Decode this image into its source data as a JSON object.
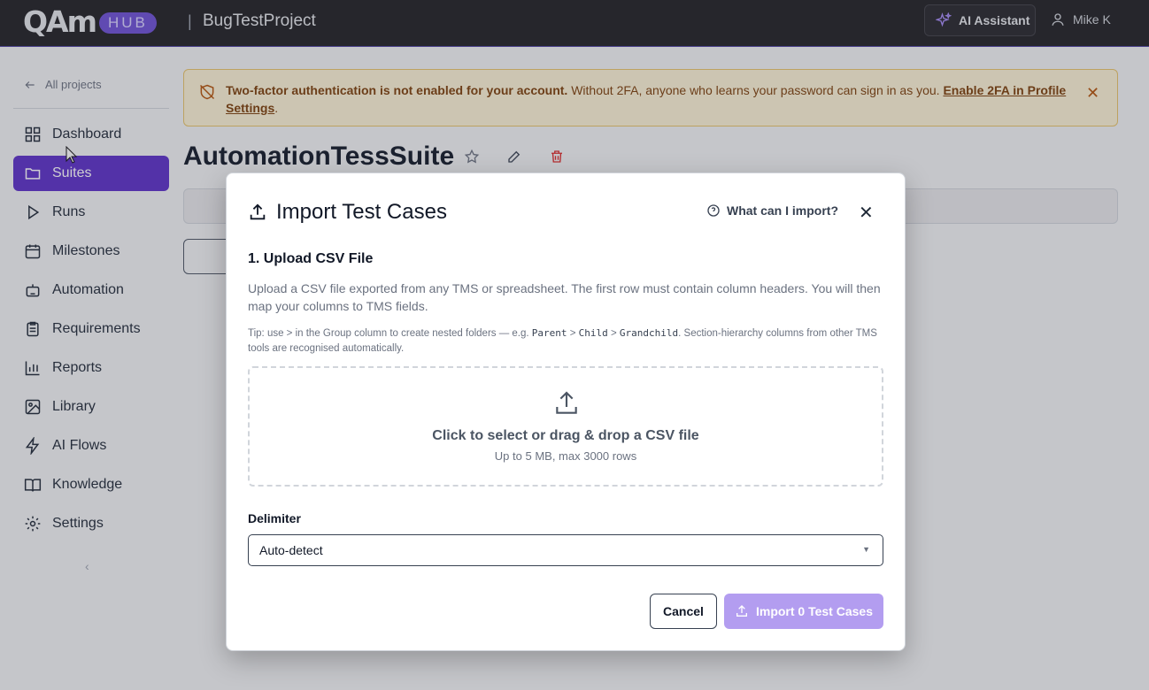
{
  "header": {
    "logo_text": "QAm",
    "logo_badge": "HUB",
    "separator": "|",
    "project_name": "BugTestProject",
    "ai_assistant_label": "AI Assistant",
    "user_name": "Mike K"
  },
  "sidebar": {
    "back_label": "All projects",
    "items": [
      {
        "label": "Dashboard",
        "icon": "dashboard-icon"
      },
      {
        "label": "Suites",
        "icon": "folder-icon",
        "active": true
      },
      {
        "label": "Runs",
        "icon": "play-icon"
      },
      {
        "label": "Milestones",
        "icon": "calendar-icon"
      },
      {
        "label": "Automation",
        "icon": "robot-icon"
      },
      {
        "label": "Requirements",
        "icon": "clipboard-icon"
      },
      {
        "label": "Reports",
        "icon": "bar-chart-icon"
      },
      {
        "label": "Library",
        "icon": "image-icon"
      },
      {
        "label": "AI Flows",
        "icon": "lightning-icon"
      },
      {
        "label": "Knowledge",
        "icon": "book-icon"
      },
      {
        "label": "Settings",
        "icon": "gear-icon"
      }
    ],
    "collapse_glyph": "‹"
  },
  "banner": {
    "bold_text": "Two-factor authentication is not enabled for your account.",
    "text": " Without 2FA, anyone who learns your password can sign in as you. ",
    "link_text": "Enable 2FA in Profile Settings",
    "end": "."
  },
  "suite": {
    "title": "AutomationTessSuite"
  },
  "modal": {
    "title": "Import Test Cases",
    "help_link": "What can I import?",
    "step_heading": "1. Upload CSV File",
    "description": "Upload a CSV file exported from any TMS or spreadsheet. The first row must contain column headers. You will then map your columns to TMS fields.",
    "tip_prefix": "Tip: use > in the Group column to create nested folders — e.g. ",
    "tip_code_1": "Parent",
    "tip_code_2": "Child",
    "tip_code_3": "Grandchild",
    "tip_arrow": ">",
    "tip_suffix": ". Section-hierarchy columns from other TMS tools are recognised automatically.",
    "dropzone_main": "Click to select or drag & drop a CSV file",
    "dropzone_sub": "Up to 5 MB, max 3000 rows",
    "delimiter_label": "Delimiter",
    "delimiter_value": "Auto-detect",
    "cancel_label": "Cancel",
    "import_label": "Import 0 Test Cases"
  },
  "colors": {
    "accent": "#5b2fc9",
    "import_button_disabled": "#b39df0",
    "banner_bg": "#fdf3d6"
  }
}
